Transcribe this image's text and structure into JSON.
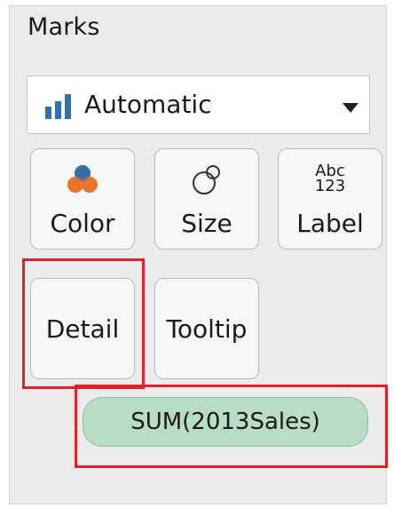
{
  "marks": {
    "title": "Marks",
    "mark_type": {
      "label": "Automatic",
      "icon": "bar-chart-icon"
    },
    "cards": [
      {
        "label": "Color",
        "icon": "color-dots-icon"
      },
      {
        "label": "Size",
        "icon": "size-circles-icon"
      },
      {
        "label": "Label",
        "icon": "abc-123-icon",
        "icon_text_top": "Abc",
        "icon_text_bottom": "123"
      },
      {
        "label": "Detail",
        "icon": ""
      },
      {
        "label": "Tooltip",
        "icon": ""
      }
    ],
    "field_pill": {
      "label": "SUM(2013Sales)",
      "color": "#b9dcc4"
    }
  },
  "colors": {
    "highlight": "#e0202a",
    "bar_icon": "#2f73a8"
  }
}
